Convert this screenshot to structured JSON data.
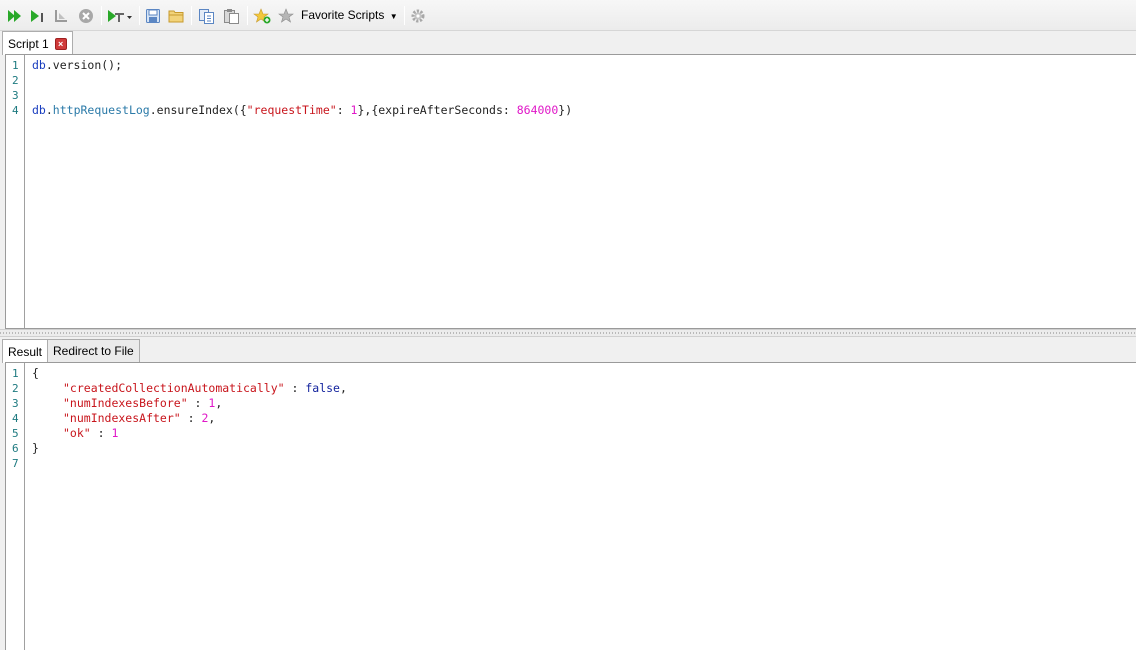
{
  "toolbar": {
    "buttons": [
      {
        "name": "execute-all-icon"
      },
      {
        "name": "execute-current-icon"
      },
      {
        "name": "explain-plan-icon"
      },
      {
        "name": "stop-icon"
      },
      {
        "name": "format-dropdown-icon"
      },
      {
        "name": "save-icon"
      },
      {
        "name": "open-icon"
      },
      {
        "name": "copy-as-icon"
      },
      {
        "name": "paste-as-icon"
      },
      {
        "name": "add-favorite-icon"
      },
      {
        "name": "favorites-icon"
      },
      {
        "name": "settings-gear-icon"
      }
    ],
    "favorite_scripts_label": "Favorite Scripts"
  },
  "editor": {
    "tab_label": "Script 1",
    "line_numbers": [
      "1",
      "2",
      "3",
      "4"
    ],
    "lines": {
      "l1_obj": "db",
      "l1_rest": ".version();",
      "l4_obj": "db",
      "l4_dot1": ".",
      "l4_coll": "httpRequestLog",
      "l4_method": ".ensureIndex({",
      "l4_key": "\"requestTime\"",
      "l4_colon1": ": ",
      "l4_val1": "1",
      "l4_mid": "},{expireAfterSeconds: ",
      "l4_val2": "864000",
      "l4_end": "})"
    }
  },
  "result": {
    "tabs": [
      {
        "label": "Result"
      },
      {
        "label": "Redirect to File"
      }
    ],
    "line_numbers": [
      "1",
      "2",
      "3",
      "4",
      "5",
      "6",
      "7"
    ],
    "lines": {
      "open": "{",
      "k1": "\"createdCollectionAutomatically\"",
      "sep1": " : ",
      "v1": "false",
      "c1": ",",
      "k2": "\"numIndexesBefore\"",
      "sep2": " : ",
      "v2": "1",
      "c2": ",",
      "k3": "\"numIndexesAfter\"",
      "sep3": " : ",
      "v3": "2",
      "c3": ",",
      "k4": "\"ok\"",
      "sep4": " : ",
      "v4": "1",
      "close": "}"
    }
  }
}
